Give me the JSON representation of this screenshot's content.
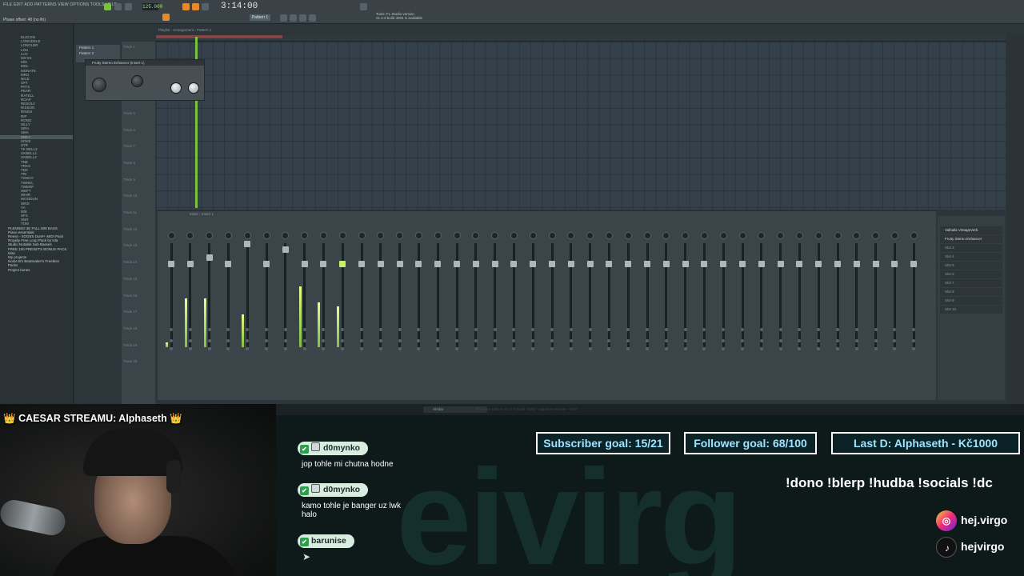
{
  "fl_studio": {
    "menu": "FILE  EDIT  ADD  PATTERNS  VIEW  OPTIONS  TOOLS  HELP",
    "hint": "Phase offset: 48 (no lfo)",
    "tempo": "125.000",
    "song_time": "3:14:00",
    "pattern_selector": "Pattern 1",
    "news": [
      "Tools: FL Studio version",
      "21.2.3 build 4004 is available"
    ],
    "playlist_title": "Playlist - Arrangement › Pattern 1",
    "patterns": [
      "Pattern 1",
      "Pattern 2"
    ],
    "plugin_title": "Fruity Stereo Enhancer (Insert 1)",
    "mixer_title": "Mixer - Insert 1",
    "mixer_slots": [
      "Valhalla VintageVerb",
      "Fruity Stereo Enhancer",
      "Slot 3",
      "Slot 4",
      "Slot 5",
      "Slot 6",
      "Slot 7",
      "Slot 8",
      "Slot 9",
      "Slot 10"
    ],
    "track_labels": [
      "Track 1",
      "Track 2",
      "Track 3",
      "Track 4",
      "Track 5",
      "Track 6",
      "Track 7",
      "Track 8",
      "Track 9",
      "Track 10",
      "Track 11",
      "Track 12",
      "Track 13",
      "Track 14",
      "Track 15",
      "Track 16",
      "Track 17",
      "Track 18",
      "Track 19",
      "Track 20"
    ],
    "browser_items": [
      "ELECSN",
      "LONGDELE",
      "LONGLBR",
      "LOU",
      "LUV",
      "MX'XX",
      "MIX",
      "MOL",
      "MONATE",
      "MRG",
      "NICE",
      "OFT",
      "PATS",
      "PEAR",
      "RATELL",
      "ROAP",
      "RESOLV",
      "RISSON",
      "RINGS",
      "RIP",
      "RONG",
      "SILLY",
      "SIRA",
      "SMA",
      "SNKY",
      "SOKE",
      "STR",
      "TK BELL3",
      "UKBELL2",
      "UKBELL3",
      "TNE",
      "TRKS",
      "TDK",
      "TRI",
      "TSNCO",
      "TWNKL",
      "TWERP",
      "WEFT",
      "WHIR",
      "WOODUN",
      "WRD",
      "YA",
      "808",
      "SFX",
      "SNR",
      "TOM"
    ],
    "browser_folders": [
      "PLENNSO 3E FALL 808 BASS",
      "Piano essentials",
      "Reesn - 5OOSS Dun#+ MIDI Pack",
      "Royalty Free Loop Pack by Isla",
      "Studio Notable Sub Basses",
      "FREE 100 PRESETS BONUS PACK",
      "Misc",
      "My projects",
      "Nonie B's Beatmaker's Freebies",
      "Packs",
      "Project bones"
    ],
    "taskbar_search": "Hledat",
    "taskbar_title": "Producer Edition v21.0.3 [build 3329] - Signature Bundle - 64bit"
  },
  "stream": {
    "webcam_title": "CAESAR STREAMU: Alphaseth",
    "crown_icon": "👑",
    "chat": [
      {
        "user": "d0mynko",
        "text": "jop tohle mi chutna hodne",
        "sub": true
      },
      {
        "user": "d0mynko",
        "text": "kamo tohle je banger uz lwk halo",
        "sub": true
      },
      {
        "user": "barunise",
        "text": "",
        "sub": false
      }
    ],
    "goals": {
      "subscriber": "Subscriber goal: 15/21",
      "follower": "Follower goal: 68/100",
      "last_donation": "Last D: Alphaseth - Kč1000"
    },
    "commands": "!dono !blerp !hudba !socials !dc",
    "socials": {
      "instagram": "hej.virgo",
      "tiktok": "hejvirgo"
    },
    "background_text": "eivirg"
  }
}
